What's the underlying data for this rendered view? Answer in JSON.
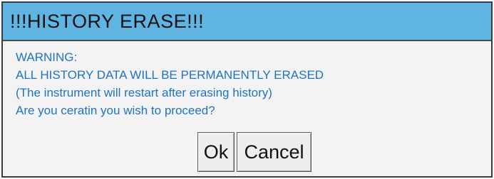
{
  "dialog": {
    "title": "!!!HISTORY ERASE!!!",
    "message_lines": [
      "WARNING:",
      "ALL HISTORY DATA WILL BE PERMANENTLY ERASED",
      "(The instrument will restart after erasing history)",
      "Are you ceratin you wish to proceed?"
    ],
    "ok_label": "Ok",
    "cancel_label": "Cancel"
  },
  "colors": {
    "titlebar_bg": "#5fb4e2",
    "message_text": "#1f73c2",
    "dialog_bg": "#f3f3f3"
  }
}
